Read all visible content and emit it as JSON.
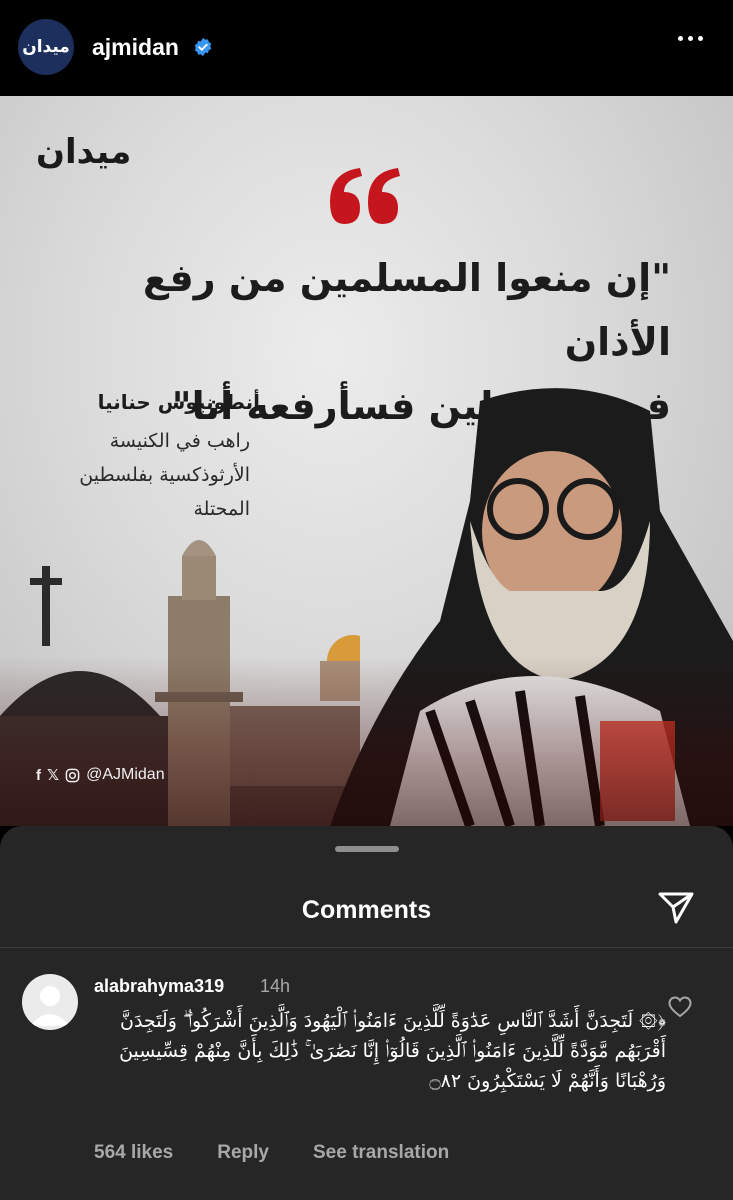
{
  "header": {
    "avatar_text": "ميدان",
    "username": "ajmidan",
    "verified_icon": "verified-badge-icon",
    "more_icon": "more-options-icon"
  },
  "post": {
    "brand": "ميدان",
    "quote_line1": "\"إن منعوا المسلمين من رفع الأذان",
    "quote_line2": "في فلسطين فسأرفعه أنا\"",
    "speaker_name": "أنطونيوس حنانيا",
    "speaker_title_1": "راهب في الكنيسة",
    "speaker_title_2": "الأرثوذكسية بفلسطين",
    "speaker_title_3": "المحتلة",
    "social_handle": "@AJMidan",
    "quote_color": "#c4161c"
  },
  "comments": {
    "title": "Comments",
    "items": [
      {
        "username": "alabrahyma319",
        "time": "14h",
        "text": "﴿۞ لَتَجِدَنَّ أَشَدَّ ٱلنَّاسِ عَدَٰوَةً لِّلَّذِينَ ءَامَنُوا۟ ٱلْيَهُودَ وَٱلَّذِينَ أَشْرَكُوا۟ ۖ وَلَتَجِدَنَّ أَقْرَبَهُم مَّوَدَّةً لِّلَّذِينَ ءَامَنُوا۟ ٱلَّذِينَ قَالُوٓا۟ إِنَّا نَصَٰرَىٰ ۚ ذَٰلِكَ بِأَنَّ مِنْهُمْ قِسِّيسِينَ وَرُهْبَانًا وَأَنَّهُمْ لَا يَسْتَكْبِرُونَ ۝٨٢",
        "likes": "564 likes",
        "reply": "Reply",
        "translate": "See translation"
      }
    ]
  }
}
